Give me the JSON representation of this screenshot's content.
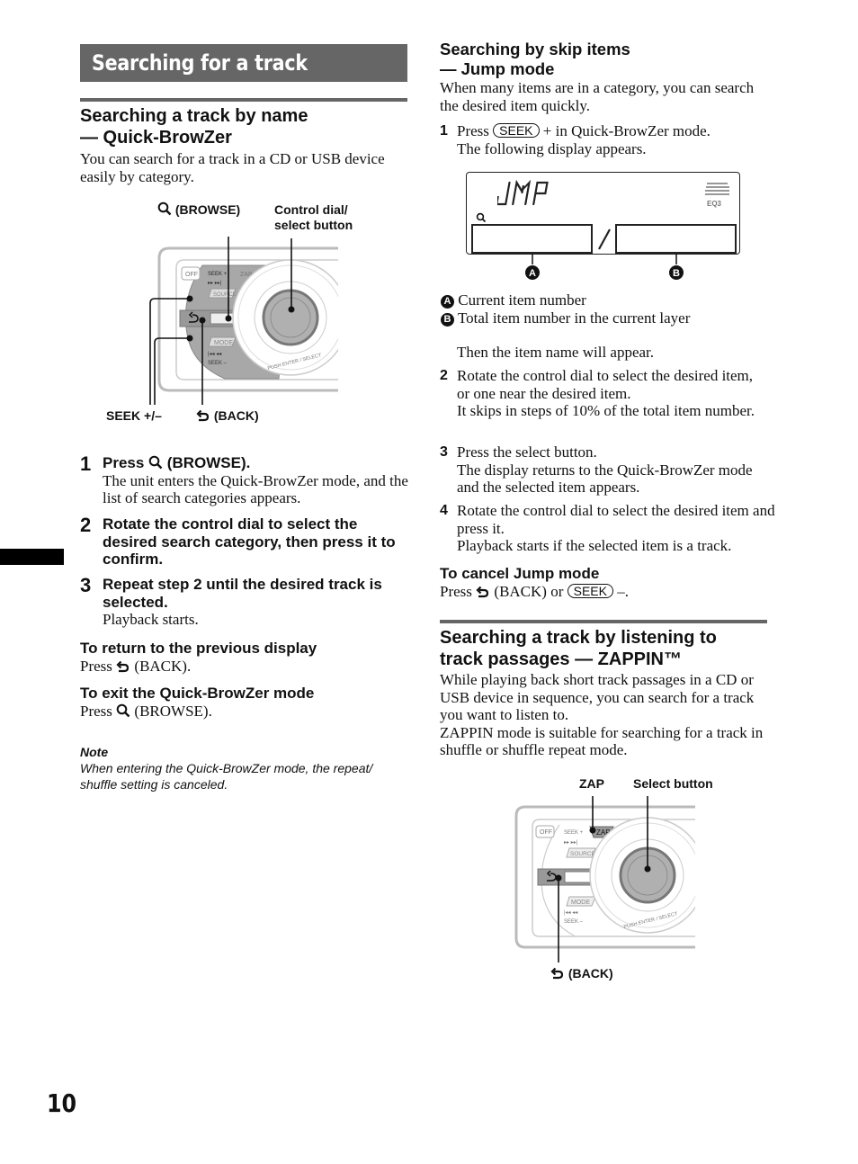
{
  "page": {
    "title": "Searching for a track",
    "page_number": "10"
  },
  "icons": {
    "browse": "magnifier-icon",
    "back": "back-arrow-icon",
    "marker_a": "A",
    "marker_b": "B"
  },
  "left": {
    "section1": {
      "heading_line1": "Searching a track by name",
      "heading_line2": "— Quick-BrowZer",
      "intro": "You can search for a track in a CD or USB device easily by category."
    },
    "diagram1": {
      "label_browse": "(BROWSE)",
      "label_control_line1": "Control dial/",
      "label_control_line2": "select button",
      "label_seek": "SEEK +/–",
      "label_back": "(BACK)",
      "panel": {
        "off": "OFF",
        "seek_plus": "SEEK +",
        "zap": "ZAP",
        "source": "SOURCE",
        "mode": "MODE",
        "seek_minus": "SEEK –",
        "push": "PUSH ENTER / SELECT"
      }
    },
    "steps": [
      {
        "num": "1",
        "head_pre": "Press",
        "head_post": "(BROWSE).",
        "body": "The unit enters the Quick-BrowZer mode, and the list of search categories appears."
      },
      {
        "num": "2",
        "head": "Rotate the control dial to select the desired search category, then press it to confirm."
      },
      {
        "num": "3",
        "head": "Repeat step 2 until the desired track is selected.",
        "body": "Playback starts."
      }
    ],
    "return": {
      "heading": "To return to the previous display",
      "press": "Press",
      "text": "(BACK)."
    },
    "exit": {
      "heading": "To exit the Quick-BrowZer mode",
      "press": "Press",
      "text": "(BROWSE)."
    },
    "note": {
      "heading": "Note",
      "text": "When entering the Quick-BrowZer mode, the repeat/ shuffle setting is canceled."
    }
  },
  "right": {
    "section2": {
      "heading_line1": "Searching by skip items",
      "heading_line2": "— Jump mode",
      "intro": "When many items are in a category, you can search the desired item quickly."
    },
    "step1": {
      "num": "1",
      "press": "Press",
      "key": "SEEK",
      "text": "+ in Quick-BrowZer mode.",
      "line2": "The following display appears."
    },
    "lcd": {
      "text": "JMP",
      "eq": "EQ3",
      "separator": "/"
    },
    "legend": [
      {
        "marker": "A",
        "text": "Current item number"
      },
      {
        "marker": "B",
        "text": "Total item number in the current layer"
      }
    ],
    "then": "Then the item name will appear.",
    "steps": [
      {
        "num": "2",
        "lines": [
          "Rotate the control dial to select the desired item, or one near the desired item.",
          "It skips in steps of 10% of the total item number."
        ]
      },
      {
        "num": "3",
        "lines": [
          "Press the select button.",
          "The display returns to the Quick-BrowZer mode and the selected item appears."
        ]
      },
      {
        "num": "4",
        "lines": [
          "Rotate the control dial to select the desired item and press it.",
          "Playback starts if the selected item is a track."
        ]
      }
    ],
    "cancel": {
      "heading": "To cancel Jump mode",
      "press": "Press",
      "back": "(BACK) or",
      "key": "SEEK",
      "tail": "–."
    },
    "section3": {
      "heading_line1": "Searching a track by listening to",
      "heading_line2": "track passages — ZAPPIN™",
      "para1": "While playing back short track passages in a CD or USB device in sequence, you can search for a track you want to listen to.",
      "para2": "ZAPPIN mode is suitable for searching for a track in shuffle or shuffle repeat mode."
    },
    "diagram2": {
      "label_zap": "ZAP",
      "label_select": "Select button",
      "label_back": "(BACK)"
    }
  }
}
